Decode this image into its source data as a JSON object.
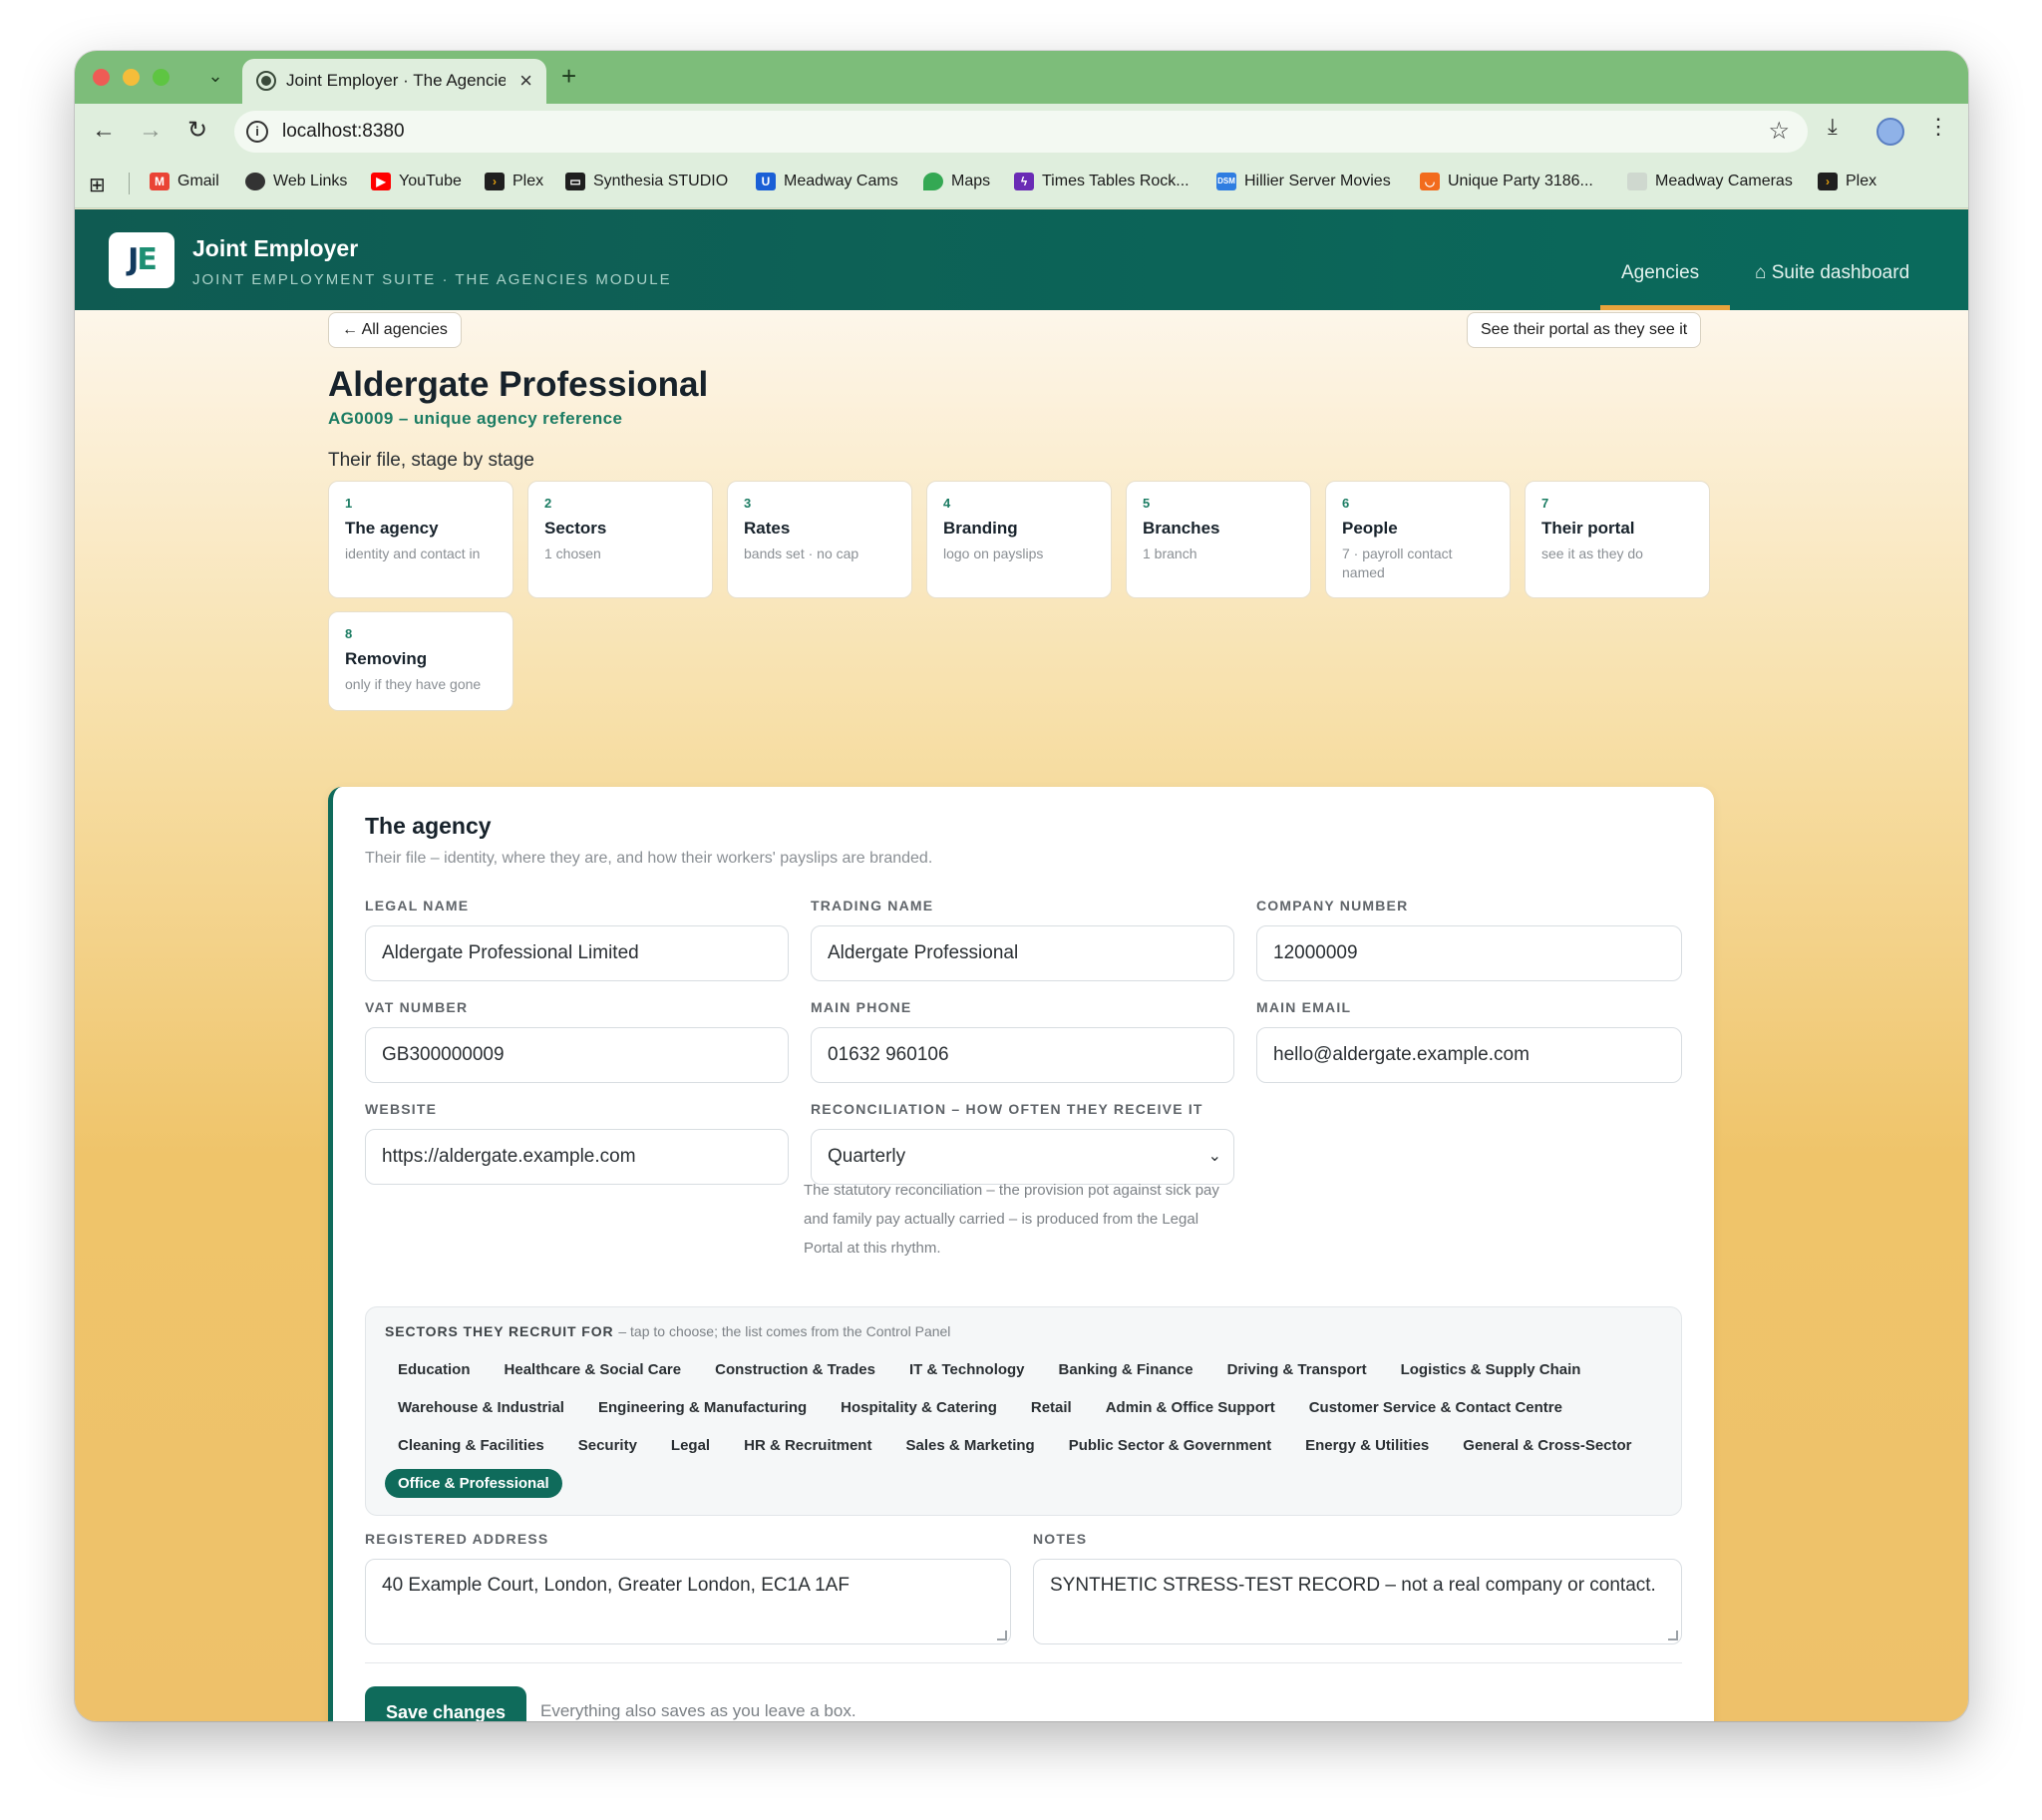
{
  "browser": {
    "tab_title": "Joint Employer · The Agencies",
    "url": "localhost:8380",
    "bookmarks": [
      {
        "label": "Gmail",
        "color": "#ea4335"
      },
      {
        "label": "Web Links",
        "color": "#333333"
      },
      {
        "label": "YouTube",
        "color": "#ff0000"
      },
      {
        "label": "Plex",
        "color": "#1f1f1f"
      },
      {
        "label": "Synthesia STUDIO",
        "color": "#1f1f1f"
      },
      {
        "label": "Meadway Cams",
        "color": "#1a5fd6"
      },
      {
        "label": "Maps",
        "color": "#34a853"
      },
      {
        "label": "Times Tables Rock...",
        "color": "#6a2bb5"
      },
      {
        "label": "Hillier Server Movies",
        "color": "#2f7de1"
      },
      {
        "label": "Unique Party 3186...",
        "color": "#f26b1d"
      },
      {
        "label": "Meadway Cameras",
        "color": "#cfd8cf"
      },
      {
        "label": "Plex",
        "color": "#1f1f1f"
      }
    ]
  },
  "app": {
    "logo_text": "JE",
    "title": "Joint Employer",
    "subtitle": "JOINT EMPLOYMENT SUITE · THE AGENCIES MODULE",
    "nav": {
      "agencies": "Agencies",
      "suite": "⌂ Suite dashboard"
    }
  },
  "page": {
    "back_label": "← All agencies",
    "portal_label": "See their portal as they see it",
    "title": "Aldergate Professional",
    "reference": "AG0009 – unique agency reference",
    "stages_heading": "Their file, stage by stage",
    "stages": [
      {
        "num": "1",
        "name": "The agency",
        "desc": "identity and contact in"
      },
      {
        "num": "2",
        "name": "Sectors",
        "desc": "1 chosen"
      },
      {
        "num": "3",
        "name": "Rates",
        "desc": "bands set · no cap"
      },
      {
        "num": "4",
        "name": "Branding",
        "desc": "logo on payslips"
      },
      {
        "num": "5",
        "name": "Branches",
        "desc": "1 branch"
      },
      {
        "num": "6",
        "name": "People",
        "desc": "7 · payroll contact named"
      },
      {
        "num": "7",
        "name": "Their portal",
        "desc": "see it as they do"
      },
      {
        "num": "8",
        "name": "Removing",
        "desc": "only if they have gone"
      }
    ]
  },
  "form": {
    "title": "The agency",
    "subtitle": "Their file – identity, where they are, and how their workers' payslips are branded.",
    "legal_name": {
      "label": "LEGAL NAME",
      "value": "Aldergate Professional Limited"
    },
    "trading_name": {
      "label": "TRADING NAME",
      "value": "Aldergate Professional"
    },
    "company_number": {
      "label": "COMPANY NUMBER",
      "value": "12000009"
    },
    "vat_number": {
      "label": "VAT NUMBER",
      "value": "GB300000009"
    },
    "main_phone": {
      "label": "MAIN PHONE",
      "value": "01632 960106"
    },
    "main_email": {
      "label": "MAIN EMAIL",
      "value": "hello@aldergate.example.com"
    },
    "website": {
      "label": "WEBSITE",
      "value": "https://aldergate.example.com"
    },
    "reconciliation": {
      "label": "RECONCILIATION – HOW OFTEN THEY RECEIVE IT",
      "value": "Quarterly",
      "help": "The statutory reconciliation – the provision pot against sick pay and family pay actually carried – is produced from the Legal Portal at this rhythm."
    },
    "sectors": {
      "heading": "SECTORS THEY RECRUIT FOR",
      "hint": "– tap to choose; the list comes from the Control Panel",
      "items": [
        "Education",
        "Healthcare & Social Care",
        "Construction & Trades",
        "IT & Technology",
        "Banking & Finance",
        "Driving & Transport",
        "Logistics & Supply Chain",
        "Warehouse & Industrial",
        "Engineering & Manufacturing",
        "Hospitality & Catering",
        "Retail",
        "Admin & Office Support",
        "Customer Service & Contact Centre",
        "Cleaning & Facilities",
        "Security",
        "Legal",
        "HR & Recruitment",
        "Sales & Marketing",
        "Public Sector & Government",
        "Energy & Utilities",
        "General & Cross-Sector",
        "Office & Professional"
      ],
      "selected": "Office & Professional"
    },
    "registered_address": {
      "label": "REGISTERED ADDRESS",
      "value": "40 Example Court, London, Greater London, EC1A 1AF"
    },
    "notes": {
      "label": "NOTES",
      "value": "SYNTHETIC STRESS-TEST RECORD – not a real company or contact."
    },
    "save_label": "Save changes",
    "save_note": "Everything also saves as you leave a box."
  }
}
